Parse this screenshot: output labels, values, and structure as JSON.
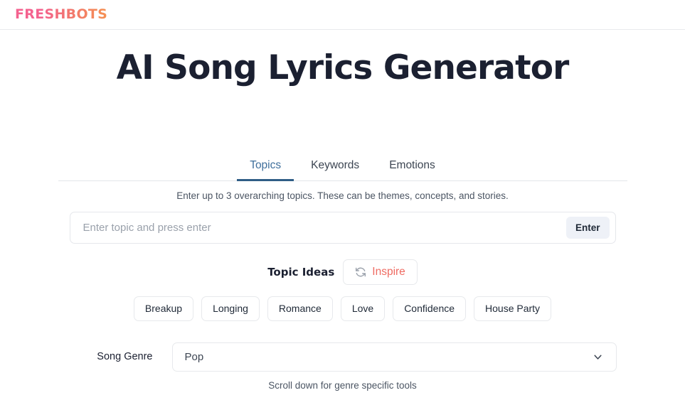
{
  "header": {
    "brand": "FRESHBOTS",
    "brand_gradient_from": "#f4628f",
    "brand_gradient_to": "#f59152"
  },
  "page": {
    "title": "AI Song Lyrics Generator"
  },
  "tabs": {
    "items": [
      {
        "label": "Topics",
        "active": true
      },
      {
        "label": "Keywords",
        "active": false
      },
      {
        "label": "Emotions",
        "active": false
      }
    ],
    "active_color": "#3f6f9c",
    "underline_color": "#2f5d86"
  },
  "topics_panel": {
    "helper_text": "Enter up to 3 overarching topics. These can be themes, concepts, and stories.",
    "input": {
      "placeholder": "Enter topic and press enter",
      "value": "",
      "submit_label": "Enter"
    },
    "ideas": {
      "label": "Topic Ideas",
      "inspire_label": "Inspire",
      "inspire_icon": "refresh-icon",
      "inspire_color": "#ef6b62",
      "chips": [
        "Breakup",
        "Longing",
        "Romance",
        "Love",
        "Confidence",
        "House Party"
      ]
    }
  },
  "genre": {
    "label": "Song Genre",
    "selected": "Pop",
    "chevron_icon": "chevron-down-icon"
  },
  "footnote": "Scroll down for genre specific tools"
}
